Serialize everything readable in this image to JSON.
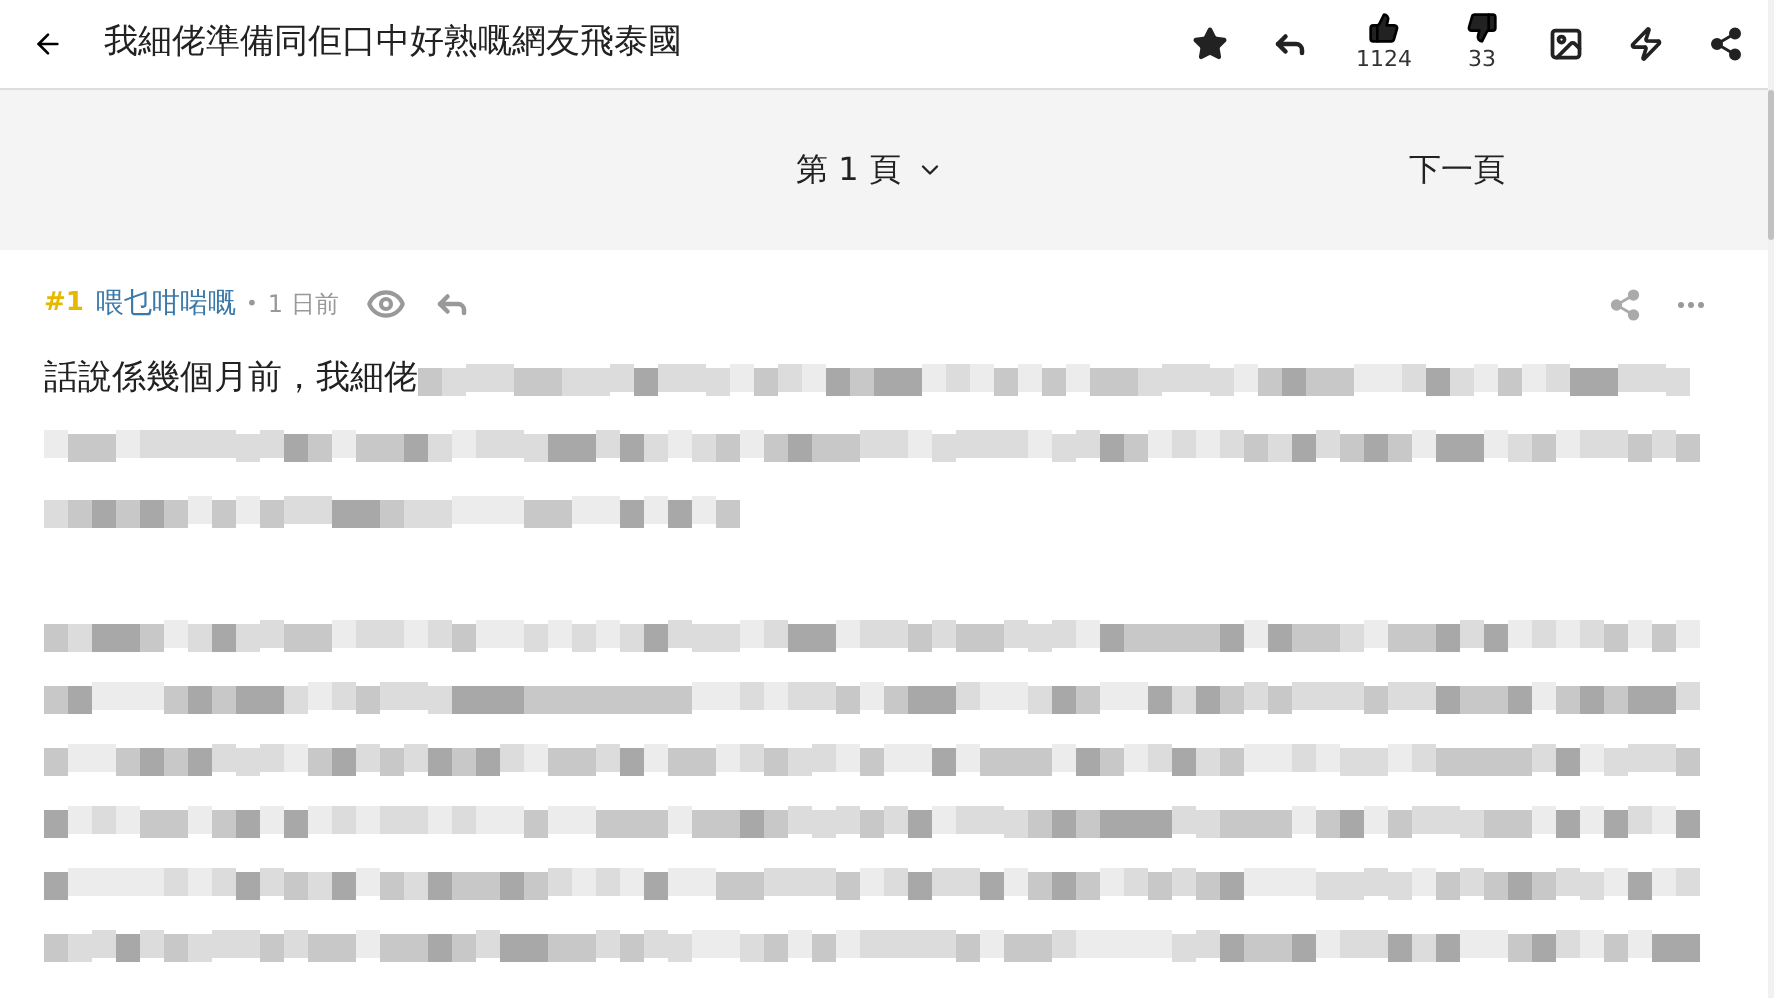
{
  "header": {
    "title": "我細佬準備同佢口中好熟嘅網友飛泰國",
    "likes": "1124",
    "dislikes": "33"
  },
  "pager": {
    "page": "第 1 頁",
    "next": "下一頁"
  },
  "post": {
    "number": "#1",
    "author": "喂乜咁啱嘅",
    "separator": "•",
    "time": "1 日前",
    "intro": "話說係幾個月前，我細佬"
  }
}
